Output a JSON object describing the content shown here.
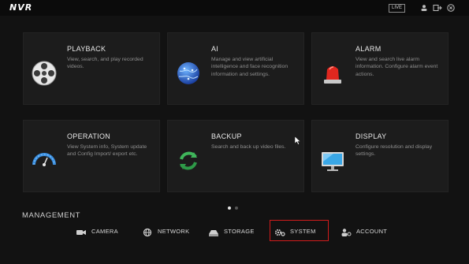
{
  "topbar": {
    "logo": "NVR",
    "live_label": "LIVE",
    "icons": [
      "user-icon",
      "logout-icon",
      "close-icon"
    ]
  },
  "cards": [
    {
      "title": "PLAYBACK",
      "desc": "View, search, and play recorded videos.",
      "icon": "film-reel-icon"
    },
    {
      "title": "AI",
      "desc": "Manage and view artificial intelligence and face recognition information and settings.",
      "icon": "globe-brain-icon"
    },
    {
      "title": "ALARM",
      "desc": "View and search live alarm information. Configure alarm event actions.",
      "icon": "alarm-light-icon"
    },
    {
      "title": "OPERATION",
      "desc": "View System info, System update and Config Import/ export etc.",
      "icon": "speedometer-icon"
    },
    {
      "title": "BACKUP",
      "desc": "Search and back up video files.",
      "icon": "refresh-arrows-icon"
    },
    {
      "title": "DISPLAY",
      "desc": "Configure resolution and display settings.",
      "icon": "monitor-icon"
    }
  ],
  "pager": {
    "pages": 2,
    "current": 1
  },
  "management": {
    "title": "MANAGEMENT",
    "items": [
      {
        "label": "CAMERA",
        "icon": "camera-icon"
      },
      {
        "label": "NETWORK",
        "icon": "network-icon"
      },
      {
        "label": "STORAGE",
        "icon": "storage-icon"
      },
      {
        "label": "SYSTEM",
        "icon": "gear-icon",
        "highlighted": true
      },
      {
        "label": "ACCOUNT",
        "icon": "account-icon"
      }
    ]
  },
  "colors": {
    "highlight": "#d11b1b",
    "background": "#121212",
    "card": "#1c1c1c"
  }
}
